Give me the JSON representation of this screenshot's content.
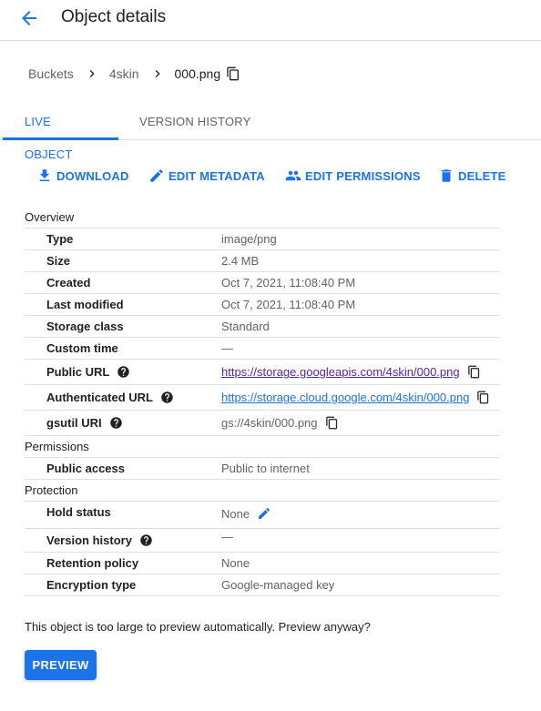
{
  "header": {
    "title": "Object details"
  },
  "breadcrumb": {
    "items": [
      "Buckets",
      "4skin"
    ],
    "current": "000.png"
  },
  "tabs": [
    {
      "label": "LIVE OBJECT",
      "active": true
    },
    {
      "label": "VERSION HISTORY",
      "active": false
    }
  ],
  "actions": {
    "download": "DOWNLOAD",
    "edit_metadata": "EDIT METADATA",
    "edit_permissions": "EDIT PERMISSIONS",
    "delete": "DELETE"
  },
  "details": {
    "overview_label": "Overview",
    "rows": [
      {
        "key": "Type",
        "value": "image/png"
      },
      {
        "key": "Size",
        "value": "2.4 MB"
      },
      {
        "key": "Created",
        "value": "Oct 7, 2021, 11:08:40 PM"
      },
      {
        "key": "Last modified",
        "value": "Oct 7, 2021, 11:08:40 PM"
      },
      {
        "key": "Storage class",
        "value": "Standard"
      },
      {
        "key": "Custom time",
        "value": "—"
      },
      {
        "key": "Public URL",
        "value": "https://storage.googleapis.com/4skin/000.png"
      },
      {
        "key": "Authenticated URL",
        "value": "https://storage.cloud.google.com/4skin/000.png"
      },
      {
        "key": "gsutil URI",
        "value": "gs://4skin/000.png"
      }
    ],
    "permissions_label": "Permissions",
    "permissions_rows": [
      {
        "key": "Public access",
        "value": "Public to internet"
      }
    ],
    "protection_label": "Protection",
    "protection_rows": [
      {
        "key": "Hold status",
        "value": "None"
      },
      {
        "key": "Version history",
        "value": "—"
      },
      {
        "key": "Retention policy",
        "value": "None"
      },
      {
        "key": "Encryption type",
        "value": "Google-managed key"
      }
    ]
  },
  "notice": "This object is too large to preview automatically. Preview anyway?",
  "preview_button": "PREVIEW",
  "colors": {
    "accent": "#1a73e8",
    "link_visited": "#5523a6",
    "text_secondary": "#5f6368",
    "divider": "#dadce0"
  }
}
